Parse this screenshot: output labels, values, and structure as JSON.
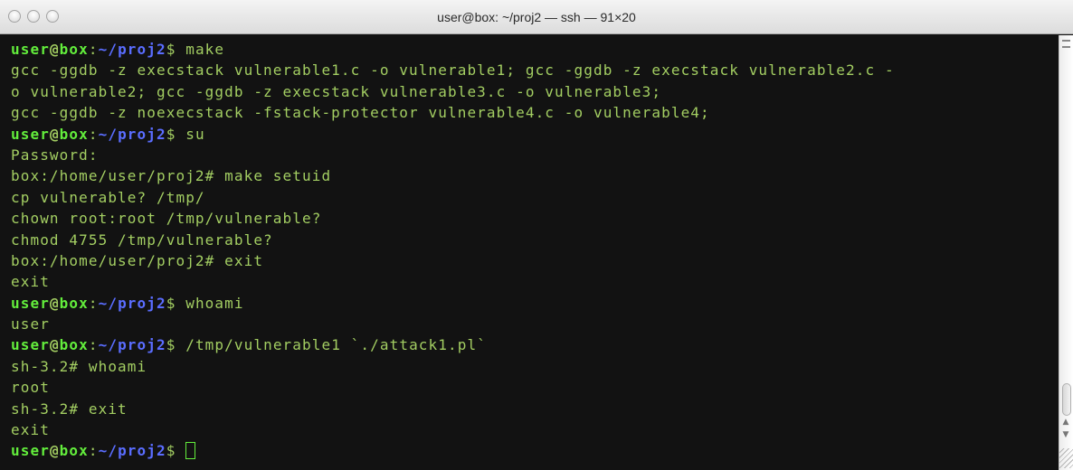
{
  "window": {
    "title": "user@box: ~/proj2 — ssh — 91×20"
  },
  "prompt": {
    "user": "user",
    "at": "@",
    "host": "box",
    "colon": ":",
    "path": "~/proj2",
    "symbol": "$ "
  },
  "terminal": {
    "cmd_make": "make",
    "out1": "gcc -ggdb -z execstack vulnerable1.c -o vulnerable1; gcc -ggdb -z execstack vulnerable2.c -",
    "out2": "o vulnerable2; gcc -ggdb -z execstack vulnerable3.c -o vulnerable3;",
    "out3": "gcc -ggdb -z noexecstack -fstack-protector vulnerable4.c -o vulnerable4;",
    "cmd_su": "su",
    "out4": "Password:",
    "out5": "box:/home/user/proj2# make setuid",
    "out6": "cp vulnerable? /tmp/",
    "out7": "chown root:root /tmp/vulnerable?",
    "out8": "chmod 4755 /tmp/vulnerable?",
    "out9": "box:/home/user/proj2# exit",
    "out10": "exit",
    "cmd_whoami": "whoami",
    "out11": "user",
    "cmd_attack": "/tmp/vulnerable1 `./attack1.pl`",
    "out12": "sh-3.2# whoami",
    "out13": "root",
    "out14": "sh-3.2# exit",
    "out15": "exit"
  },
  "colors": {
    "background": "#121212",
    "text": "#a3ce62",
    "prompt_user_host": "#63ee3c",
    "prompt_path": "#5a6dff"
  },
  "icons": {
    "close": "close-button-icon",
    "minimize": "minimize-button-icon",
    "zoom": "zoom-button-icon",
    "cursor": "block-cursor-icon"
  }
}
